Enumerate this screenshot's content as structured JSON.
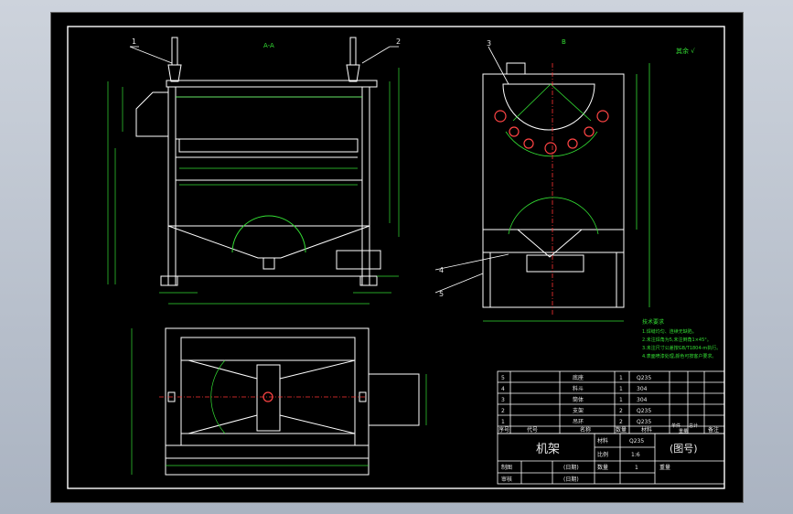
{
  "drawing": {
    "top_view_title": "A-A",
    "view_label_b": "B",
    "callouts": [
      "1",
      "2",
      "3",
      "4",
      "5"
    ],
    "tech_requirements_title": "技术要求",
    "tech_requirements": [
      "1.焊缝均匀、连续无缺陷。",
      "2.未注焊角为5,未注倒角1×45°。",
      "3.未注尺寸公差按GB/T1804-m执行。",
      "4.表面喷漆处理,颜色可按客户要求。"
    ],
    "roughness_note": "其余 √"
  },
  "bom": {
    "rows": [
      {
        "no": "5",
        "code": "",
        "name": "底座",
        "qty": "1",
        "material": "Q235"
      },
      {
        "no": "4",
        "code": "",
        "name": "料斗",
        "qty": "1",
        "material": "304"
      },
      {
        "no": "3",
        "code": "",
        "name": "筒体",
        "qty": "1",
        "material": "304"
      },
      {
        "no": "2",
        "code": "",
        "name": "支架",
        "qty": "2",
        "material": "Q235"
      },
      {
        "no": "1",
        "code": "",
        "name": "吊环",
        "qty": "2",
        "material": "Q235"
      }
    ],
    "headers": {
      "no": "序号",
      "code": "代号",
      "name": "名称",
      "qty": "数量",
      "material": "材料",
      "unit_weight": "单件",
      "total_weight": "总计",
      "weight": "重量",
      "remarks": "备注"
    }
  },
  "title_block": {
    "part_name": "机架",
    "material_label": "材料",
    "material_value": "Q235",
    "scale_label": "比例",
    "scale_value": "1:6",
    "drawing_number": "(图号)",
    "drawn_label": "制图",
    "checked_label": "审核",
    "date_label": "(日期)",
    "qty_label": "数量",
    "qty_value": "1",
    "weight_label": "重量"
  },
  "colors": {
    "paper": "#000000",
    "outline": "#ffffff",
    "dimension": "#33dd33",
    "centerline": "#ff3333",
    "callout": "#ffffff",
    "window_bg": "#b8c0cc"
  }
}
